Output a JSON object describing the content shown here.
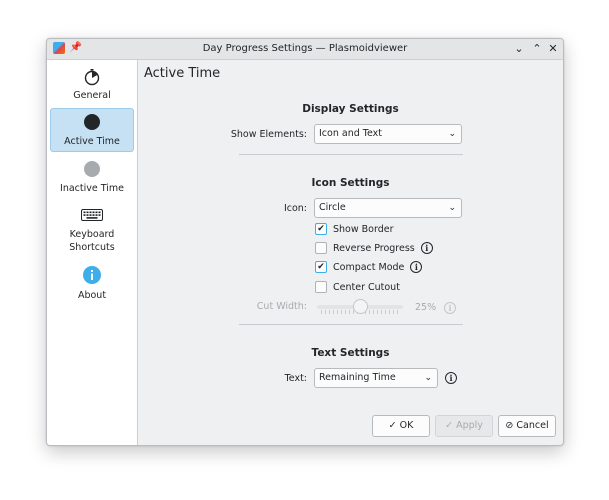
{
  "window": {
    "title": "Day Progress Settings — Plasmoidviewer"
  },
  "sidebar": {
    "items": [
      {
        "label": "General",
        "icon": "timer-icon"
      },
      {
        "label": "Active Time",
        "icon": "filled-circle-icon"
      },
      {
        "label": "Inactive Time",
        "icon": "grey-circle-icon"
      },
      {
        "label": "Keyboard",
        "label2": "Shortcuts",
        "icon": "keyboard-icon"
      },
      {
        "label": "About",
        "icon": "info-icon"
      }
    ],
    "active": "Active Time"
  },
  "page": {
    "title": "Active Time"
  },
  "display": {
    "heading": "Display Settings",
    "show_elements_label": "Show Elements:",
    "show_elements_value": "Icon and Text"
  },
  "icon_settings": {
    "heading": "Icon Settings",
    "icon_label": "Icon:",
    "icon_value": "Circle",
    "show_border": "Show Border",
    "reverse_progress": "Reverse Progress",
    "compact_mode": "Compact Mode",
    "center_cutout": "Center Cutout",
    "cut_width_label": "Cut Width:",
    "cut_width_value": "25%",
    "checked": {
      "show_border": true,
      "reverse_progress": false,
      "compact_mode": true,
      "center_cutout": false
    },
    "cut_width_level": 0.5
  },
  "text_settings": {
    "heading": "Text Settings",
    "text_label": "Text:",
    "text_value": "Remaining Time"
  },
  "buttons": {
    "ok": "OK",
    "apply": "Apply",
    "cancel": "Cancel"
  },
  "colors": {
    "accent": "#3daee9",
    "active_bg": "#c5e1f3",
    "about_icon": "#3daee9"
  }
}
